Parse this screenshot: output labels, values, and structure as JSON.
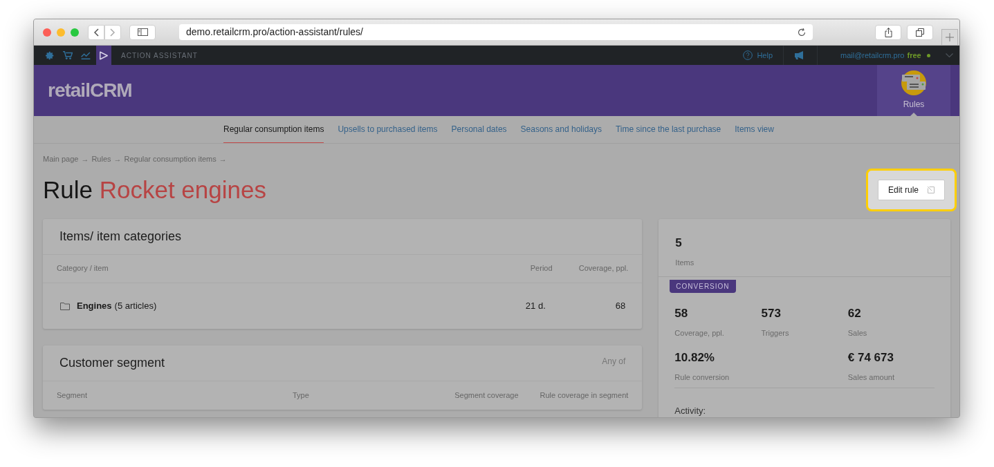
{
  "browser": {
    "url": "demo.retailcrm.pro/action-assistant/rules/"
  },
  "top_bar": {
    "app_icons": [
      {
        "kind": "settings",
        "selected": false
      },
      {
        "kind": "cart",
        "selected": false
      },
      {
        "kind": "chart",
        "selected": false
      },
      {
        "kind": "assistant",
        "selected": true
      }
    ],
    "section": "ACTION ASSISTANT",
    "help": "Help",
    "account": "mail@retailcrm.pro",
    "plan": "free"
  },
  "header": {
    "logo": "retailCRM",
    "rules_button": "Rules"
  },
  "tabs": [
    {
      "label": "Regular consumption items",
      "selected": true
    },
    {
      "label": "Upsells to purchased items",
      "selected": false
    },
    {
      "label": "Personal dates",
      "selected": false
    },
    {
      "label": "Seasons and holidays",
      "selected": false
    },
    {
      "label": "Time since the last purchase",
      "selected": false
    },
    {
      "label": "Items view",
      "selected": false
    }
  ],
  "breadcrumbs": [
    {
      "label": "Main page",
      "separator": "→"
    },
    {
      "label": "Rules",
      "separator": "→"
    },
    {
      "label": "Regular consumption items",
      "separator": "→"
    }
  ],
  "title": {
    "prefix": "Rule",
    "name": "Rocket engines"
  },
  "edit_button": "Edit rule",
  "items_card": {
    "title": "Items/ item categories",
    "columns": [
      "Category / item",
      "Period",
      "Coverage, ppl."
    ],
    "rows": [
      {
        "name": "Engines",
        "note": "(5 articles)",
        "period": "21 d.",
        "coverage": "68"
      }
    ]
  },
  "segment_card": {
    "title": "Customer segment",
    "mode": "Any of",
    "columns": [
      "Segment",
      "Type",
      "Segment coverage",
      "Rule coverage in segment"
    ]
  },
  "stats": {
    "items_value": "5",
    "items_label": "Items",
    "badge": "CONVERSION",
    "metrics": [
      {
        "value": "58",
        "label": "Coverage, ppl."
      },
      {
        "value": "573",
        "label": "Triggers"
      },
      {
        "value": "62",
        "label": "Sales"
      },
      {
        "value": "10.82%",
        "label": "Rule conversion"
      },
      {
        "value": "€ 74 673",
        "label": "Sales amount"
      }
    ],
    "activity": "Activity:"
  }
}
